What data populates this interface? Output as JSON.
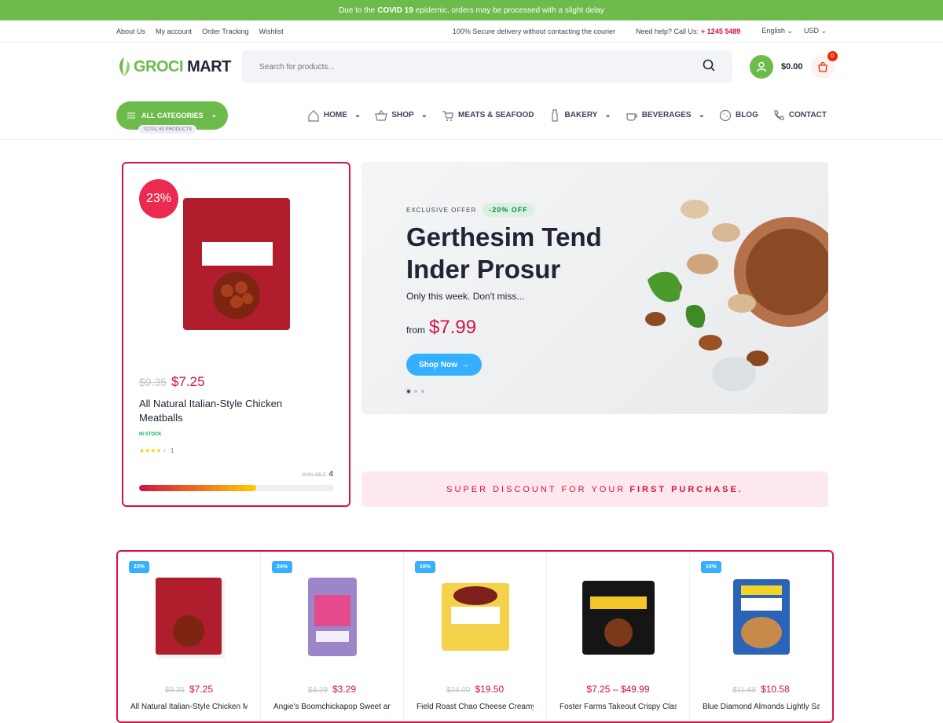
{
  "topbar": {
    "pre": "Due to the",
    "bold": "COVID 19",
    "post": "epidemic, orders may be processed with a slight delay"
  },
  "util": {
    "links": [
      "About Us",
      "My account",
      "Order Tracking",
      "Wishlist"
    ],
    "secure": "100% Secure delivery without contacting the courier",
    "help": "Need help? Call Us:",
    "phone": "+ 1245 5489",
    "lang": "English",
    "currency": "USD"
  },
  "header": {
    "logo_a": "GROCI",
    "logo_b": "MART",
    "search_placeholder": "Search for products...",
    "cart_total": "$0.00",
    "cart_count": "0"
  },
  "nav": {
    "categories": "ALL CATEGORIES",
    "cat_badge": "TOTAL 63 PRODUCTS",
    "items": [
      "HOME",
      "SHOP",
      "MEATS & SEAFOOD",
      "BAKERY",
      "BEVERAGES",
      "BLOG",
      "CONTACT"
    ]
  },
  "featured": {
    "discount": "23%",
    "old_price": "$9.35",
    "price": "$7.25",
    "name": "All Natural Italian-Style Chicken Meatballs",
    "stock": "IN STOCK",
    "stars": 4,
    "reviews": "1",
    "available_label": "AVAILABLE:",
    "available": "4",
    "progress": 0.6
  },
  "banner": {
    "exclusive": "EXCLUSIVE OFFER",
    "tag": "-20% OFF",
    "title": "Gerthesim Tend Inder Prosur",
    "sub": "Only this week. Don't miss...",
    "from": "from",
    "price": "$7.99",
    "button": "Shop Now"
  },
  "promo": {
    "text": "SUPER DISCOUNT FOR YOUR",
    "bold": "FIRST PURCHASE."
  },
  "products": [
    {
      "tag": "23%",
      "old": "$9.35",
      "price": "$7.25",
      "name": "All Natural Italian-Style Chicken Meatballs"
    },
    {
      "tag": "24%",
      "old": "$4.29",
      "price": "$3.29",
      "name": "Angie's Boomchickapop Sweet and Salty"
    },
    {
      "tag": "19%",
      "old": "$24.00",
      "price": "$19.50",
      "name": "Field Roast Chao Cheese Creamy Original"
    },
    {
      "tag": "",
      "old": "",
      "price": "$7.25 – $49.99",
      "name": "Foster Farms Takeout Crispy Classic"
    },
    {
      "tag": "10%",
      "old": "$11.68",
      "price": "$10.58",
      "name": "Blue Diamond Almonds Lightly Salted"
    }
  ],
  "colors": {
    "green": "#6dbb4b",
    "accent": "#d51243",
    "blue": "#35afff"
  }
}
